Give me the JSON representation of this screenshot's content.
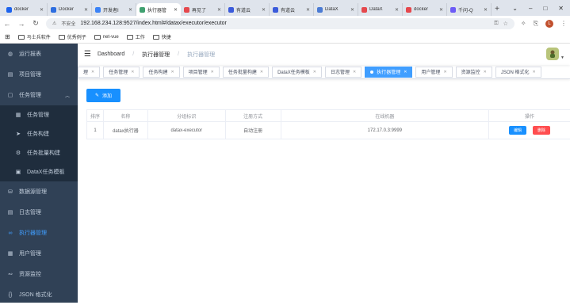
{
  "browser": {
    "tabs": [
      {
        "label": "docker",
        "color": "#1d63ed"
      },
      {
        "label": "Docker",
        "color": "#2e6ee0"
      },
      {
        "label": "开发者I",
        "color": "#3b82f6"
      },
      {
        "label": "执行器管",
        "color": "#40a070"
      },
      {
        "label": "再见了",
        "color": "#e5484d"
      },
      {
        "label": "有道云",
        "color": "#3b5bdb"
      },
      {
        "label": "有道云",
        "color": "#3b5bdb"
      },
      {
        "label": "DataX",
        "color": "#4b7bd4"
      },
      {
        "label": "DataX",
        "color": "#e5484d"
      },
      {
        "label": "docker",
        "color": "#e5484d"
      },
      {
        "label": "千问-Q",
        "color": "#6d5cf6"
      }
    ],
    "new_tab": "+",
    "window_controls": [
      "⌄",
      "–",
      "□",
      "✕"
    ],
    "security_label": "不安全",
    "url": "192.168.234.128:9527/index.html#/datax/executor/executor",
    "profile_initial": "L",
    "bookmarks": [
      "马士兵软件",
      "优秀例子",
      "net-vue",
      "工作",
      "快捷"
    ]
  },
  "sidebar": {
    "items": [
      {
        "label": "运行报表",
        "icon": "dashboard-icon"
      },
      {
        "label": "项目管理",
        "icon": "project-icon"
      },
      {
        "label": "任务管理",
        "icon": "task-icon",
        "expanded": true
      }
    ],
    "sub_items": [
      {
        "label": "任务管理",
        "icon": "list-icon"
      },
      {
        "label": "任务构建",
        "icon": "send-icon"
      },
      {
        "label": "任务批量构建",
        "icon": "gear-icon"
      },
      {
        "label": "DataX任务模板",
        "icon": "template-icon"
      }
    ],
    "items_after": [
      {
        "label": "数据源管理",
        "icon": "database-icon"
      },
      {
        "label": "日志管理",
        "icon": "log-icon"
      },
      {
        "label": "执行器管理",
        "icon": "link-icon",
        "active": true
      },
      {
        "label": "用户管理",
        "icon": "user-icon"
      },
      {
        "label": "资源监控",
        "icon": "monitor-icon"
      },
      {
        "label": "JSON 格式化",
        "icon": "code-icon"
      }
    ]
  },
  "breadcrumb": [
    "Dashboard",
    "执行器管理",
    "执行器管理"
  ],
  "tags": [
    {
      "label": "理"
    },
    {
      "label": "任务管理"
    },
    {
      "label": "任务构建"
    },
    {
      "label": "项目管理"
    },
    {
      "label": "任务批量构建"
    },
    {
      "label": "DataX任务模板"
    },
    {
      "label": "日志管理"
    },
    {
      "label": "执行器管理",
      "active": true
    },
    {
      "label": "用户管理"
    },
    {
      "label": "资源监控"
    },
    {
      "label": "JSON 格式化"
    }
  ],
  "add_button": "添加",
  "table": {
    "headers": [
      "排序",
      "名称",
      "分组标识",
      "注册方式",
      "在线机器",
      "操作"
    ],
    "rows": [
      {
        "order": "1",
        "name": "datax执行器",
        "app_name": "datax-executor",
        "register": "自动注册",
        "address": "172.17.0.3:9999",
        "edit": "编辑",
        "delete": "删除"
      }
    ]
  }
}
